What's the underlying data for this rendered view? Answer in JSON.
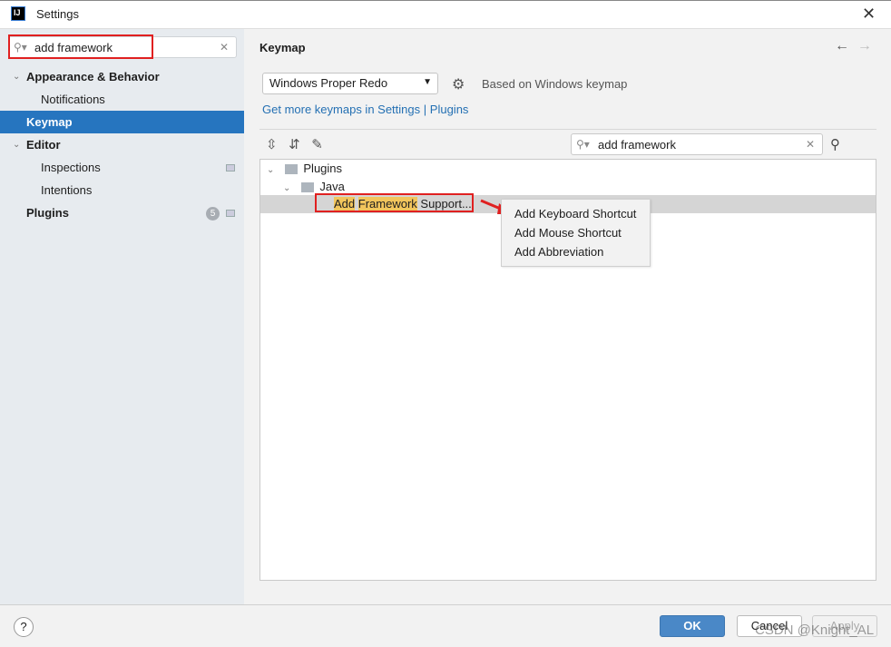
{
  "window": {
    "title": "Settings",
    "logo": "IJ"
  },
  "sidebar": {
    "search": {
      "value": "add framework"
    },
    "items": [
      {
        "label": "Appearance & Behavior",
        "expanded": true
      },
      {
        "label": "Notifications"
      },
      {
        "label": "Keymap",
        "selected": true
      },
      {
        "label": "Editor",
        "expanded": true
      },
      {
        "label": "Inspections"
      },
      {
        "label": "Intentions"
      },
      {
        "label": "Plugins",
        "badge": "5"
      }
    ]
  },
  "main": {
    "title": "Keymap",
    "keymap_select": "Windows Proper Redo",
    "based_on": "Based on Windows keymap",
    "links": {
      "get_more": "Get more keymaps in Settings",
      "sep": "|",
      "plugins": "Plugins"
    },
    "search": {
      "value": "add framework"
    },
    "tree": {
      "root": "Plugins",
      "child": "Java",
      "action": {
        "hl1": "Add",
        "hl2": "Framework",
        "rest": "Support..."
      }
    },
    "context_menu": [
      "Add Keyboard Shortcut",
      "Add Mouse Shortcut",
      "Add Abbreviation"
    ]
  },
  "footer": {
    "help": "?",
    "ok": "OK",
    "cancel": "Cancel",
    "apply": "Apply"
  },
  "watermark": "CSDN @Knight_AL",
  "colors": {
    "selection": "#2675bf",
    "highlight": "#f2c55c",
    "annotation": "#e02020",
    "link": "#2470b3"
  }
}
